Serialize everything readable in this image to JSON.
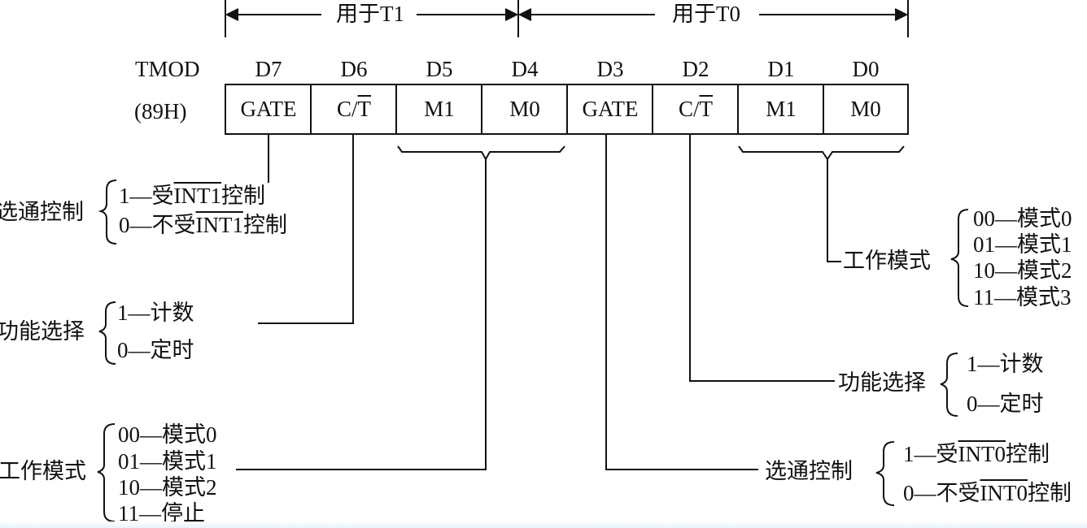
{
  "top_labels": {
    "t1": "用于T1",
    "t0": "用于T0"
  },
  "register": {
    "name": "TMOD",
    "address": "(89H)",
    "bits": [
      "D7",
      "D6",
      "D5",
      "D4",
      "D3",
      "D2",
      "D1",
      "D0"
    ],
    "fields": [
      "GATE",
      "C/",
      "M1",
      "M0",
      "GATE",
      "C/",
      "M1",
      "M0"
    ],
    "t_bar": "T"
  },
  "t1_gate": {
    "title": "选通控制",
    "opt1": {
      "prefix": "1—受",
      "overline": "INT1",
      "suffix": "控制"
    },
    "opt0": {
      "prefix": "0—不受",
      "overline": "INT1",
      "suffix": "控制"
    }
  },
  "t1_ct": {
    "title": "功能选择",
    "opt1": "1—计数",
    "opt0": "0—定时"
  },
  "t1_mode": {
    "title": "工作模式",
    "opts": [
      "00—模式0",
      "01—模式1",
      "10—模式2",
      "11—停止"
    ]
  },
  "t0_mode": {
    "title": "工作模式",
    "opts": [
      "00—模式0",
      "01—模式1",
      "10—模式2",
      "11—模式3"
    ]
  },
  "t0_ct": {
    "title": "功能选择",
    "opt1": "1—计数",
    "opt0": "0—定时"
  },
  "t0_gate": {
    "title": "选通控制",
    "opt1": {
      "prefix": "1—受",
      "overline": "INT0",
      "suffix": "控制"
    },
    "opt0": {
      "prefix": "0—不受",
      "overline": "INT0",
      "suffix": "控制"
    }
  }
}
